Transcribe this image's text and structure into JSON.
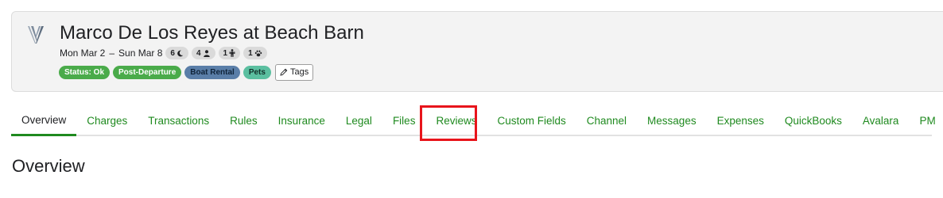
{
  "header": {
    "title": "Marco De Los Reyes at Beach Barn",
    "start_date": "Mon Mar 2",
    "date_separator": "–",
    "end_date": "Sun Mar 8",
    "stats": [
      {
        "value": "6",
        "icon": "moon-icon"
      },
      {
        "value": "4",
        "icon": "adult-icon"
      },
      {
        "value": "1",
        "icon": "child-icon"
      },
      {
        "value": "1",
        "icon": "paw-icon"
      }
    ],
    "badges": [
      {
        "label": "Status: Ok",
        "color": "#4aab4a"
      },
      {
        "label": "Post-Departure",
        "color": "#4aab4a"
      },
      {
        "label": "Boat Rental",
        "color": "#5a7ea8"
      },
      {
        "label": "Pets",
        "color": "#5bbfa0"
      }
    ],
    "tags_label": "Tags"
  },
  "tabs": [
    {
      "label": "Overview",
      "active": true
    },
    {
      "label": "Charges"
    },
    {
      "label": "Transactions"
    },
    {
      "label": "Rules"
    },
    {
      "label": "Insurance"
    },
    {
      "label": "Legal"
    },
    {
      "label": "Files"
    },
    {
      "label": "Reviews",
      "highlighted": true
    },
    {
      "label": "Custom Fields"
    },
    {
      "label": "Channel"
    },
    {
      "label": "Messages"
    },
    {
      "label": "Expenses"
    },
    {
      "label": "QuickBooks"
    },
    {
      "label": "Avalara"
    },
    {
      "label": "PM"
    }
  ],
  "main": {
    "section_title": "Overview"
  },
  "colors": {
    "accent_green": "#1f8a1f",
    "highlight_red": "#e8141b"
  }
}
